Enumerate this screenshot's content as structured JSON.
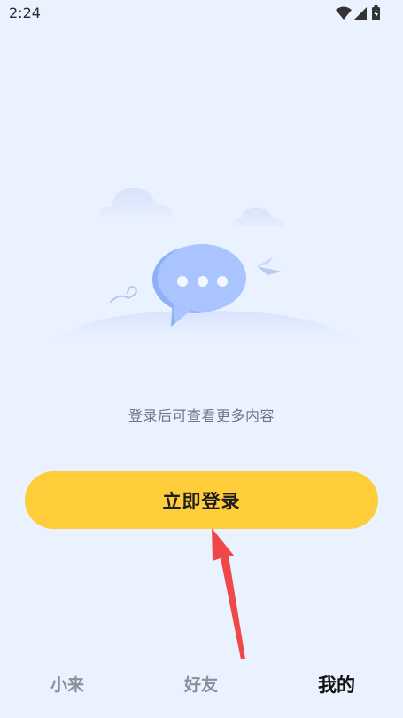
{
  "status_bar": {
    "time": "2:24",
    "icons": [
      "wifi-icon",
      "cellular-signal-icon",
      "battery-charging-icon"
    ]
  },
  "empty_state": {
    "illustration": "chat-bubble-illustration",
    "hint": "登录后可查看更多内容"
  },
  "login_button": {
    "label": "立即登录"
  },
  "tab_bar": {
    "tabs": [
      {
        "label": "小来",
        "active": false
      },
      {
        "label": "好友",
        "active": false
      },
      {
        "label": "我的",
        "active": true
      }
    ]
  },
  "colors": {
    "background": "#EBF2FF",
    "button": "#FFCD39",
    "arrow": "#F04848",
    "bubble": "#A9C4FF"
  }
}
